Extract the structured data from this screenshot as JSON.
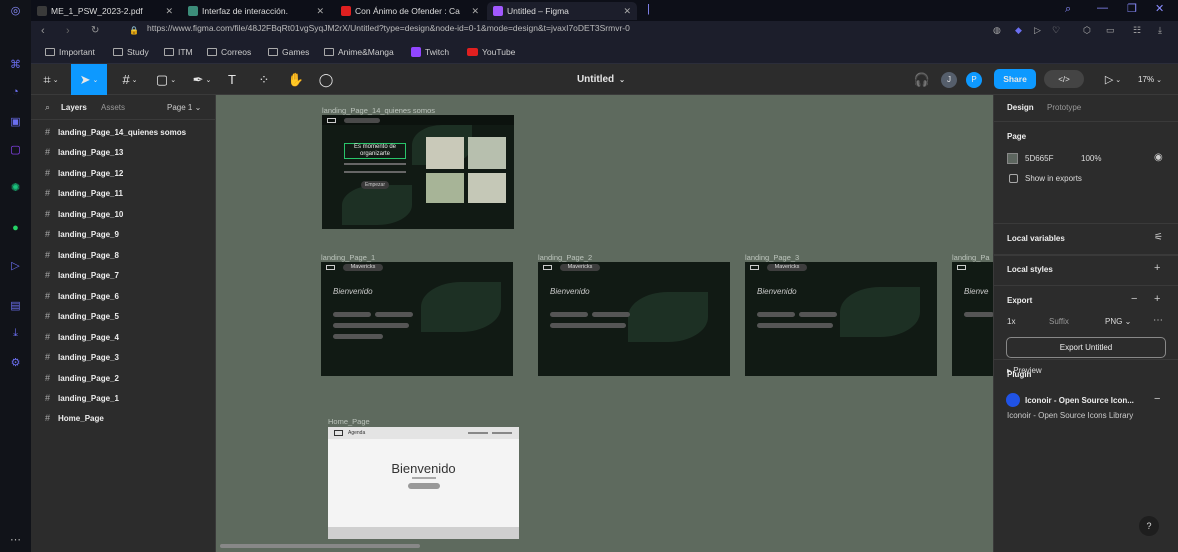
{
  "browser": {
    "tabs": [
      {
        "title": "ME_1_PSW_2023-2.pdf",
        "color": "#3a3a3a"
      },
      {
        "title": "Interfaz de interacción.",
        "color": "#3c8d7a"
      },
      {
        "title": "Con Ánimo de Ofender : Ca",
        "color": "#e02020"
      },
      {
        "title": "Untitled – Figma",
        "color": "#a259ff"
      }
    ],
    "url": "https://www.figma.com/file/48J2FBqRt01vgSyqJM2rX/Untitled?type=design&node-id=0-1&mode=design&t=jvaxI7oDET3Srmvr-0",
    "bookmarks": [
      "Important",
      "Study",
      "ITM",
      "Correos",
      "Games",
      "Anime&Manga",
      "Twitch",
      "YouTube"
    ]
  },
  "toolbar": {
    "file_name": "Untitled",
    "avatars": [
      "J",
      "P"
    ],
    "share_label": "Share",
    "zoom": "17%"
  },
  "left_panel": {
    "tab_layers": "Layers",
    "tab_assets": "Assets",
    "page_selector": "Page 1",
    "layers": [
      "landing_Page_14_quienes somos",
      "landing_Page_13",
      "landing_Page_12",
      "landing_Page_11",
      "landing_Page_10",
      "landing_Page_9",
      "landing_Page_8",
      "landing_Page_7",
      "landing_Page_6",
      "landing_Page_5",
      "landing_Page_4",
      "landing_Page_3",
      "landing_Page_2",
      "landing_Page_1",
      "Home_Page"
    ]
  },
  "canvas": {
    "frames": {
      "top": {
        "label": "landing_Page_14_quienes somos",
        "headline": "Es momento de organizarte",
        "button": "Empezar"
      },
      "row": [
        {
          "label": "landing_Page_1",
          "brand": "Mavericks",
          "welcome": "Bienvenido"
        },
        {
          "label": "landing_Page_2",
          "brand": "Mavericks",
          "welcome": "Bienvenido"
        },
        {
          "label": "landing_Page_3",
          "brand": "Mavericks",
          "welcome": "Bienvenido"
        },
        {
          "label": "landing_Pa",
          "brand": "",
          "welcome": "Bienve"
        }
      ],
      "home": {
        "label": "Home_Page",
        "brand": "Agenda",
        "welcome": "Bienvenido"
      }
    }
  },
  "right_panel": {
    "tab_design": "Design",
    "tab_prototype": "Prototype",
    "page_title": "Page",
    "page_color": "5D665F",
    "page_opacity": "100%",
    "show_in_exports": "Show in exports",
    "local_variables": "Local variables",
    "local_styles": "Local styles",
    "export_title": "Export",
    "export_scale": "1x",
    "export_suffix": "Suffix",
    "export_format": "PNG",
    "export_button": "Export Untitled",
    "preview": "Preview",
    "plugin_title": "Plugin",
    "plugin_name": "Iconoir - Open Source Icon...",
    "plugin_desc": "Iconoir - Open Source Icons Library",
    "help": "?"
  },
  "colors": {
    "accent": "#0d99ff",
    "canvas_bg": "#5d665f",
    "panel": "#2c2c2c"
  }
}
